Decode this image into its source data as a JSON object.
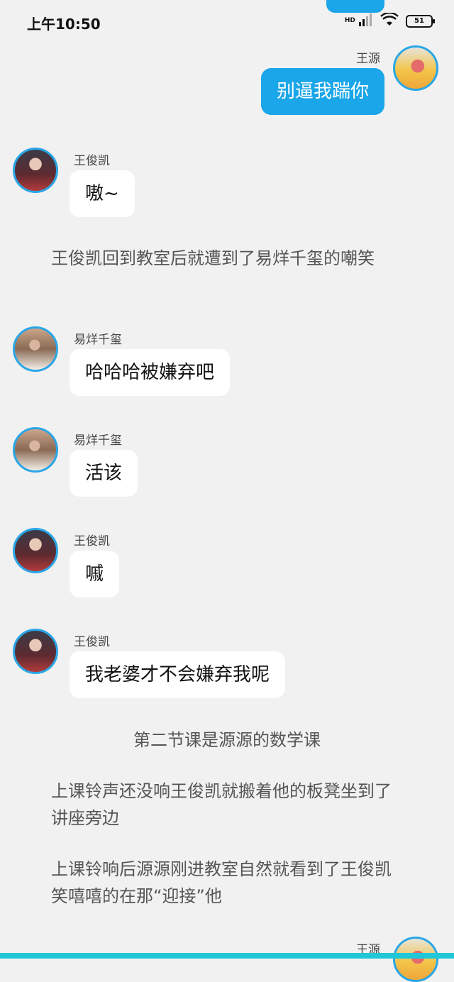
{
  "status_bar": {
    "time": "上午10:50",
    "signal_label": "HD",
    "battery": "51"
  },
  "messages": [
    {
      "side": "right",
      "sender": "王源",
      "text": "别逼我踹你"
    },
    {
      "side": "left",
      "sender": "王俊凯",
      "text": "嗷~"
    },
    {
      "side": "left",
      "sender": "易烊千玺",
      "text": "哈哈哈被嫌弃吧"
    },
    {
      "side": "left",
      "sender": "易烊千玺",
      "text": "活该"
    },
    {
      "side": "left",
      "sender": "王俊凯",
      "text": "嘁"
    },
    {
      "side": "left",
      "sender": "王俊凯",
      "text": "我老婆才不会嫌弃我呢"
    },
    {
      "side": "right",
      "sender": "王源",
      "text": ""
    }
  ],
  "narrations": [
    "王俊凯回到教室后就遭到了易烊千玺的嘲笑",
    "第二节课是源源的数学课",
    "上课铃声还没响王俊凯就搬着他的板凳坐到了讲座旁边",
    "上课铃响后源源刚进教室自然就看到了王俊凯笑嘻嘻的在那“迎接”他"
  ]
}
